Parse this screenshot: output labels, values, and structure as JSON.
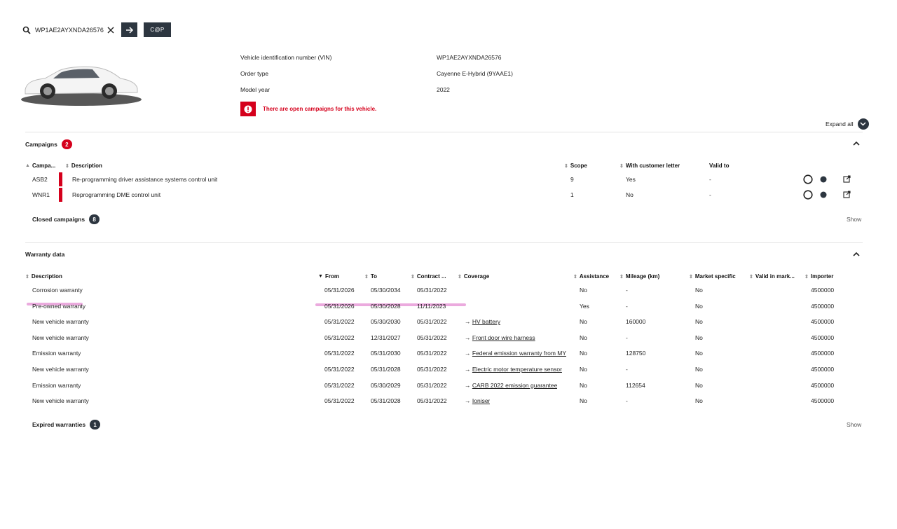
{
  "search": {
    "value": "WP1AE2AYXNDA26576",
    "cp_label": "C@P"
  },
  "vehicle": {
    "rows": [
      {
        "label": "Vehicle identification number (VIN)",
        "value": "WP1AE2AYXNDA26576"
      },
      {
        "label": "Order type",
        "value": "Cayenne E-Hybrid (9YAAE1)"
      },
      {
        "label": "Model year",
        "value": "2022"
      }
    ],
    "alert": "There are open campaigns for this vehicle."
  },
  "expand_all": "Expand all",
  "campaigns": {
    "title": "Campaigns",
    "count": "2",
    "headers": {
      "campaign": "Campa...",
      "description": "Description",
      "scope": "Scope",
      "letter": "With customer letter",
      "valid_to": "Valid to"
    },
    "rows": [
      {
        "code": "ASB2",
        "description": "Re-programming driver assistance systems control unit",
        "scope": "9",
        "letter": "Yes",
        "valid_to": "-"
      },
      {
        "code": "WNR1",
        "description": "Reprogramming DME control unit",
        "scope": "1",
        "letter": "No",
        "valid_to": "-"
      }
    ],
    "closed_label": "Closed campaigns",
    "closed_count": "8",
    "show": "Show"
  },
  "warranty": {
    "title": "Warranty data",
    "headers": {
      "description": "Description",
      "from": "From",
      "to": "To",
      "contract": "Contract ...",
      "coverage": "Coverage",
      "assistance": "Assistance",
      "mileage": "Mileage (km)",
      "market": "Market specific",
      "valid_in_market": "Valid in mark...",
      "importer": "Importer"
    },
    "rows": [
      {
        "description": "Corrosion warranty",
        "from": "05/31/2026",
        "to": "05/30/2034",
        "contract": "05/31/2022",
        "coverage": "",
        "assistance": "No",
        "mileage": "-",
        "market": "No",
        "importer": "4500000"
      },
      {
        "description": "Pre-owned warranty",
        "from": "05/31/2026",
        "to": "05/30/2028",
        "contract": "11/11/2023",
        "coverage": "",
        "assistance": "Yes",
        "mileage": "-",
        "market": "No",
        "importer": "4500000"
      },
      {
        "description": "New vehicle warranty",
        "from": "05/31/2022",
        "to": "05/30/2030",
        "contract": "05/31/2022",
        "coverage": "HV battery",
        "assistance": "No",
        "mileage": "160000",
        "market": "No",
        "importer": "4500000"
      },
      {
        "description": "New vehicle warranty",
        "from": "05/31/2022",
        "to": "12/31/2027",
        "contract": "05/31/2022",
        "coverage": "Front door wire harness",
        "assistance": "No",
        "mileage": "-",
        "market": "No",
        "importer": "4500000"
      },
      {
        "description": "Emission warranty",
        "from": "05/31/2022",
        "to": "05/31/2030",
        "contract": "05/31/2022",
        "coverage": "Federal emission warranty from MY",
        "assistance": "No",
        "mileage": "128750",
        "market": "No",
        "importer": "4500000"
      },
      {
        "description": "New vehicle warranty",
        "from": "05/31/2022",
        "to": "05/31/2028",
        "contract": "05/31/2022",
        "coverage": "Electric motor temperature sensor",
        "assistance": "No",
        "mileage": "-",
        "market": "No",
        "importer": "4500000"
      },
      {
        "description": "Emission warranty",
        "from": "05/31/2022",
        "to": "05/30/2029",
        "contract": "05/31/2022",
        "coverage": "CARB 2022 emission guarantee",
        "assistance": "No",
        "mileage": "112654",
        "market": "No",
        "importer": "4500000"
      },
      {
        "description": "New vehicle warranty",
        "from": "05/31/2022",
        "to": "05/31/2028",
        "contract": "05/31/2022",
        "coverage": "Ioniser",
        "assistance": "No",
        "mileage": "-",
        "market": "No",
        "importer": "4500000"
      }
    ],
    "expired_label": "Expired warranties",
    "expired_count": "1",
    "show": "Show"
  },
  "colors": {
    "accent_red": "#d5001c",
    "dark": "#2d3640",
    "highlight": "#e79bd8"
  }
}
